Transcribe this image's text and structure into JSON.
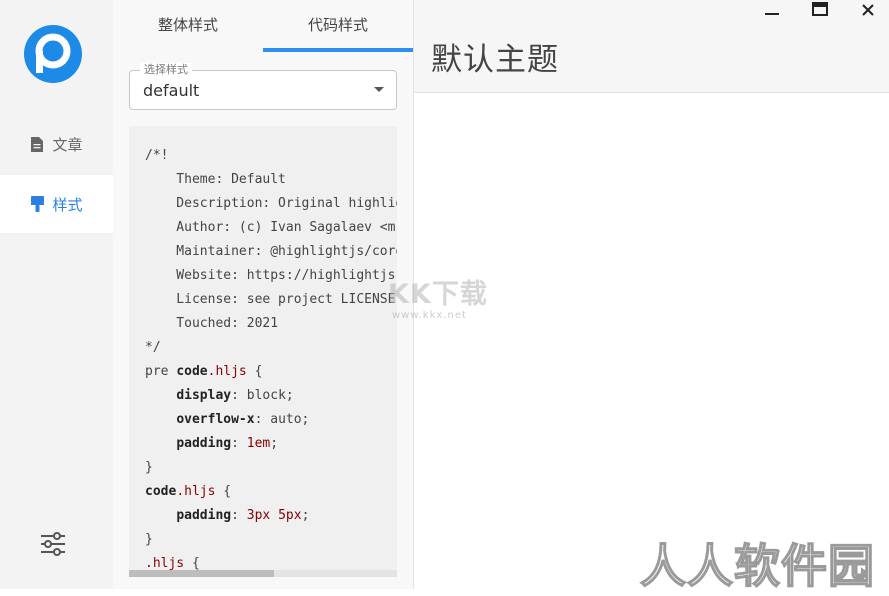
{
  "nav": {
    "items": [
      {
        "label": "文章",
        "icon": "document-icon"
      },
      {
        "label": "样式",
        "icon": "brush-icon"
      }
    ],
    "settings_icon": "sliders-icon",
    "accent": "#2a7fe2"
  },
  "panel": {
    "tabs": [
      {
        "label": "整体样式"
      },
      {
        "label": "代码样式"
      }
    ],
    "select": {
      "legend": "选择样式",
      "value": "default"
    },
    "code_lines": [
      "/*!",
      "    Theme: Default",
      "    Description: Original highlightjs style",
      "    Author: (c) Ivan Sagalaev <m",
      "    Maintainer: @highlightjs/core-team",
      "    Website: https://highlightjs.org/",
      "    License: see project LICENSE",
      "    Touched: 2021",
      "*/",
      "pre code.hljs {",
      "    display: block;",
      "    overflow-x: auto;",
      "    padding: 1em;",
      "}",
      "code.hljs {",
      "    padding: 3px 5px;",
      "}",
      ".hljs {"
    ]
  },
  "preview": {
    "title": "默认主题"
  },
  "window": {
    "minimize_icon": "minimize-icon",
    "maximize_icon": "maximize-icon",
    "close_icon": "close-icon"
  },
  "watermarks": {
    "center": "KK下载",
    "center_sub": "www.kkx.net",
    "corner": "人人软件园"
  }
}
